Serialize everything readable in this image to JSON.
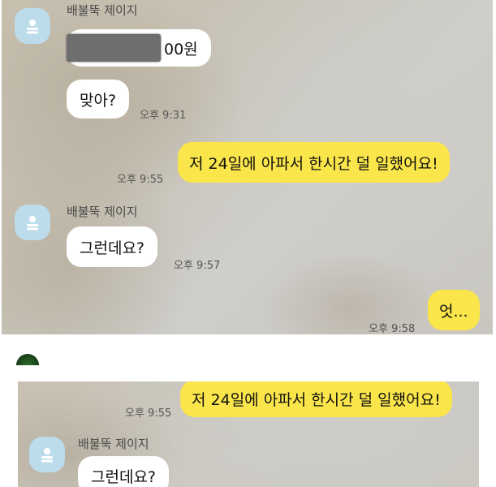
{
  "top_panel": {
    "sender_name": "배불뚝 제이지",
    "msg1_amount": "00원",
    "msg2_text": "맞아?",
    "msg2_time": "오후 9:31",
    "msg3_text": "저 24일에 아파서 한시간 덜 일했어요!",
    "msg3_time": "오후 9:55",
    "sender_name_2": "배불뚝 제이지",
    "msg4_text": "그런데요?",
    "msg4_time": "오후 9:57",
    "msg5_text": "엇...",
    "msg5_time": "오후 9:58"
  },
  "bottom_panel": {
    "msg1_text": "저 24일에 아파서 한시간 덜 일했어요!",
    "msg1_time": "오후 9:55",
    "sender_name": "배불뚝 제이지",
    "msg2_text": "그런데요?"
  },
  "colors": {
    "outgoing_bubble": "#fae54a",
    "incoming_bubble": "#ffffff",
    "avatar": "#bcdceb"
  },
  "icons": [
    "default-profile-icon",
    "emoji-icon"
  ]
}
